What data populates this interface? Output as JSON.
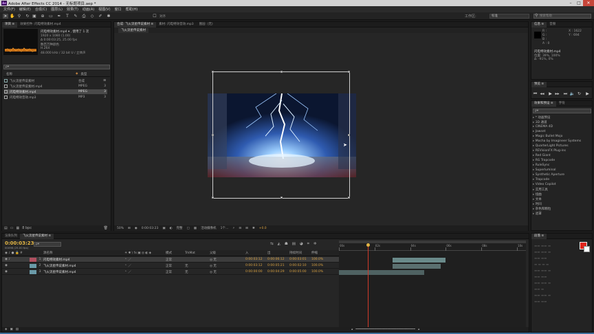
{
  "window": {
    "title": "Adobe After Effects CC 2014 - 无标题项目.aep *"
  },
  "menu": [
    "文件(F)",
    "编辑(E)",
    "合成(C)",
    "图层(L)",
    "效果(T)",
    "动画(A)",
    "视图(V)",
    "窗口",
    "帮助(H)"
  ],
  "toolbar": {
    "align_label": "对齐",
    "workspace_label": "工作区:",
    "workspace_value": "标准",
    "search_placeholder": "搜索帮助"
  },
  "project_panel": {
    "tabs": [
      "项目 ≡",
      "效果控件: 闪电特效素材.mp4"
    ],
    "selected_name": "闪电特效素材.mp4 ▾ , 使用了 1 次",
    "info_lines": [
      "1920 x 1080 (1.00)",
      "Δ 0:00:03:25, 25.00 fps",
      "数百万种颜色",
      "H.264",
      "48.000 kHz / 32 bit U / 立体声"
    ],
    "search_placeholder": "ρ▾",
    "columns": {
      "name": "名称",
      "type": "类型"
    },
    "items": [
      {
        "name": "飞火流星传说素材",
        "type": "合成",
        "extra": ""
      },
      {
        "name": "飞火流星传说素材.mp4",
        "type": "MPEG",
        "extra": "3"
      },
      {
        "name": "闪电特效素材.mp4",
        "type": "MPEG",
        "extra": "3"
      },
      {
        "name": "闪电特效音效.mp3",
        "type": "MP3",
        "extra": "3"
      }
    ],
    "bpc": "8 bpc"
  },
  "comp_panel": {
    "tabs": [
      "合成: 飞火流星传说素材 ≡",
      "素材: 闪电特效音效.mp3",
      "图层: (无)"
    ],
    "subtab": "飞火流星传说素材",
    "zoom": "50%",
    "timecode": "0:00:03:23",
    "resolution": "完整",
    "camera": "活动摄像机",
    "views": "1个...",
    "exposure": "+0.0"
  },
  "info_panel": {
    "tabs": [
      "信息 ≡",
      "音频"
    ],
    "rgba": [
      "R :",
      "G :",
      "B :",
      "A : 0"
    ],
    "xy": [
      "X : 1622",
      "Y : 694"
    ],
    "layer_name": "闪电特效素材.mp4",
    "coords": [
      "位置: 39%, 100%",
      "Δ: -91%, 0%"
    ]
  },
  "preview_panel": {
    "tabs": [
      "预览 ≡"
    ]
  },
  "effects_panel": {
    "tabs": [
      "效果和预设 ≡",
      "字符"
    ],
    "search_placeholder": "ρ▾",
    "items": [
      "* 动画预设",
      "3D 通道",
      "CINEMA 4D",
      "Jawset",
      "Magic Bullet Mojo",
      "Mocha by Imagineer Systems",
      "QuarterLight Pictures",
      "REVisionFX Plug-ins",
      "Red Giant",
      "RG Trapcode",
      "RuleSync",
      "Superluminal",
      "Synthetic Aperture",
      "Trapcode",
      "Video Copilot",
      "实用工具",
      "扭曲",
      "文本",
      "时间",
      "杂色和颗粒",
      "遮罩"
    ]
  },
  "paragraph_panel": {
    "tabs": [
      "段落 ≡"
    ],
    "color_swatch": "#e1241b"
  },
  "timeline": {
    "tabs": [
      "渲染队列",
      "飞火流星传说素材 ≡"
    ],
    "current_time": "0:00:03:23",
    "frame_info": "00098 (25.00 fps)",
    "search_placeholder": "ρ▾",
    "columns": {
      "name": "源名称",
      "mode": "模式",
      "trkmat": "TrkMat",
      "parent": "父级",
      "in": "入",
      "out": "出",
      "duration": "持续时间",
      "stretch": "伸缩"
    },
    "layers": [
      {
        "num": "1",
        "name": "闪电特效素材.mp4",
        "mode": "正常",
        "trkmat": "",
        "parent": "无",
        "in": "0:00:03:12",
        "out": "0:00:06:12",
        "duration": "0:00:03:01",
        "stretch": "100.0%"
      },
      {
        "num": "2",
        "name": "飞火流星传说素材.mp4",
        "mode": "正常",
        "trkmat": "无",
        "parent": "无",
        "in": "0:00:03:12",
        "out": "0:00:05:21",
        "duration": "0:00:02:10",
        "stretch": "100.0%"
      },
      {
        "num": "3",
        "name": "飞火流星传说素材.mp4",
        "mode": "正常",
        "trkmat": "无",
        "parent": "无",
        "in": "0:00:00:00",
        "out": "0:00:04:29",
        "duration": "0:00:05:00",
        "stretch": "100.0%"
      }
    ],
    "ruler_marks": [
      "00s",
      "02s",
      "04s",
      "06s",
      "08s",
      "10s"
    ],
    "playhead_fraction": 0.155,
    "bars": [
      {
        "start_s": 3.0,
        "end_s": 6.0,
        "color": "#6a8a8a"
      },
      {
        "start_s": 3.0,
        "end_s": 5.7,
        "color": "#5b7070"
      },
      {
        "start_s": 0.0,
        "end_s": 4.8,
        "color": "#4f6262"
      }
    ],
    "ruler_range_s": [
      0,
      10.5
    ]
  },
  "colors": {
    "accent": "#e2b544",
    "selection": "#4a4a4a",
    "close": "#c7463a"
  }
}
